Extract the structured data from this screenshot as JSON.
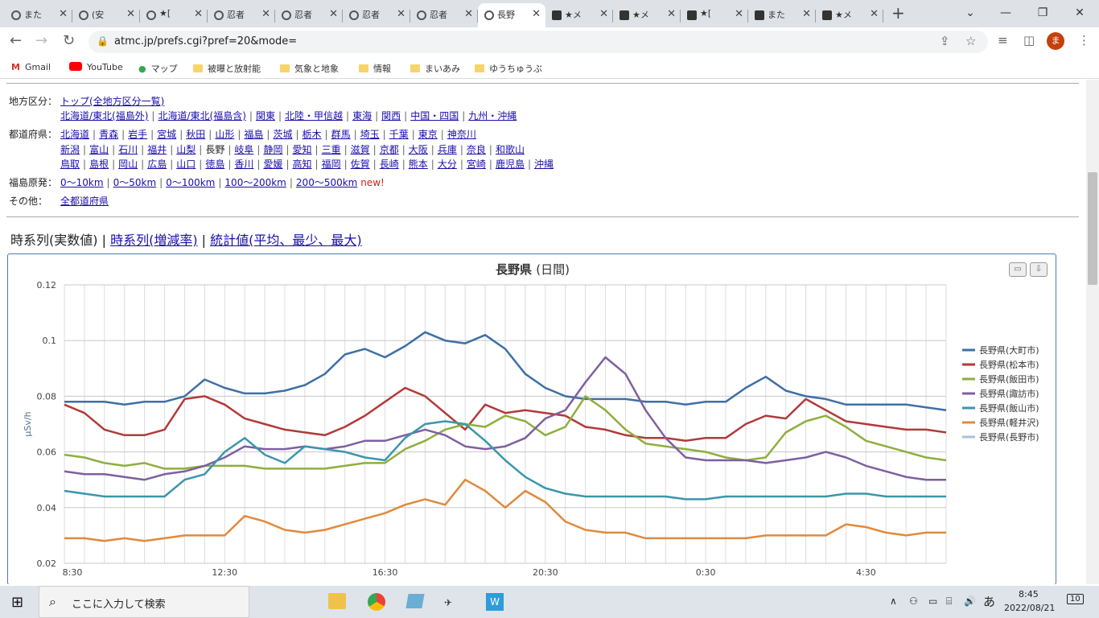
{
  "browser": {
    "tabs": [
      {
        "label": "また",
        "fav": "circle"
      },
      {
        "label": "(安",
        "fav": "circle"
      },
      {
        "label": "★[",
        "fav": "circle"
      },
      {
        "label": "忍者",
        "fav": "circle"
      },
      {
        "label": "忍者",
        "fav": "circle"
      },
      {
        "label": "忍者",
        "fav": "circle"
      },
      {
        "label": "忍者",
        "fav": "circle"
      },
      {
        "label": "長野",
        "fav": "circle",
        "active": true
      },
      {
        "label": "★メ",
        "fav": "square"
      },
      {
        "label": "★メ",
        "fav": "square"
      },
      {
        "label": "★[",
        "fav": "square"
      },
      {
        "label": "また",
        "fav": "square"
      },
      {
        "label": "★メ",
        "fav": "square"
      }
    ],
    "url": "atmc.jp/prefs.cgi?pref=20&mode=",
    "profile_initial": "ま",
    "bookmarks": [
      "Gmail",
      "YouTube",
      "マップ",
      "被曝と放射能",
      "気象と地象",
      "情報",
      "まいあみ",
      "ゆうちゅうぶ"
    ]
  },
  "nav": {
    "region": {
      "label": "地方区分：",
      "line1": [
        "トップ(全地方区分一覧)"
      ],
      "line2": [
        "北海道/東北(福島外)",
        "北海道/東北(福島含)",
        "関東",
        "北陸・甲信越",
        "東海",
        "関西",
        "中国・四国",
        "九州・沖縄"
      ]
    },
    "prefs": {
      "label": "都道府県：",
      "line1": [
        "北海道",
        "青森",
        "岩手",
        "宮城",
        "秋田",
        "山形",
        "福島",
        "茨城",
        "栃木",
        "群馬",
        "埼玉",
        "千葉",
        "東京",
        "神奈川"
      ],
      "line2": [
        "新潟",
        "富山",
        "石川",
        "福井",
        "山梨",
        "長野",
        "岐阜",
        "静岡",
        "愛知",
        "三重",
        "滋賀",
        "京都",
        "大阪",
        "兵庫",
        "奈良",
        "和歌山"
      ],
      "line3": [
        "鳥取",
        "島根",
        "岡山",
        "広島",
        "山口",
        "徳島",
        "香川",
        "愛媛",
        "高知",
        "福岡",
        "佐賀",
        "長崎",
        "熊本",
        "大分",
        "宮崎",
        "鹿児島",
        "沖縄"
      ]
    },
    "fukushima": {
      "label": "福島原発：",
      "items": [
        "0〜10km",
        "0〜50km",
        "0〜100km",
        "100〜200km",
        "200〜500km"
      ],
      "new": "new!"
    },
    "other": {
      "label": "その他：",
      "items": [
        "全都道府県"
      ]
    }
  },
  "views": {
    "current": "時系列(実数値)",
    "link1": "時系列(増減率)",
    "link2": "統計値(平均、最少、最大)",
    "sep": "|"
  },
  "chart_data": {
    "type": "line",
    "title": "長野県",
    "subtitle": "(日間)",
    "ylabel": "μSv/h",
    "ylim": [
      0.02,
      0.12
    ],
    "yticks": [
      "0.12",
      "0.1",
      "0.08",
      "0.06",
      "0.04",
      "0.02"
    ],
    "xticks": [
      "8:30",
      "12:30",
      "16:30",
      "20:30",
      "0:30",
      "4:30"
    ],
    "grid": true,
    "legend_position": "right",
    "series": [
      {
        "name": "長野県(大町市)",
        "color": "#3f6fa5",
        "values": [
          0.078,
          0.078,
          0.078,
          0.077,
          0.078,
          0.078,
          0.08,
          0.086,
          0.083,
          0.081,
          0.081,
          0.082,
          0.084,
          0.088,
          0.095,
          0.097,
          0.094,
          0.098,
          0.103,
          0.1,
          0.099,
          0.102,
          0.097,
          0.088,
          0.083,
          0.08,
          0.079,
          0.079,
          0.079,
          0.078,
          0.078,
          0.077,
          0.078,
          0.078,
          0.083,
          0.087,
          0.082,
          0.08,
          0.079,
          0.077,
          0.077,
          0.077,
          0.077,
          0.076,
          0.075
        ]
      },
      {
        "name": "長野県(松本市)",
        "color": "#b23a3a",
        "values": [
          0.077,
          0.074,
          0.068,
          0.066,
          0.066,
          0.068,
          0.079,
          0.08,
          0.077,
          0.072,
          0.07,
          0.068,
          0.067,
          0.066,
          0.069,
          0.073,
          0.078,
          0.083,
          0.08,
          0.074,
          0.068,
          0.077,
          0.074,
          0.075,
          0.074,
          0.073,
          0.069,
          0.068,
          0.066,
          0.065,
          0.065,
          0.064,
          0.065,
          0.065,
          0.07,
          0.073,
          0.072,
          0.079,
          0.075,
          0.071,
          0.07,
          0.069,
          0.068,
          0.068,
          0.067
        ]
      },
      {
        "name": "長野県(飯田市)",
        "color": "#8fae3e",
        "values": [
          0.059,
          0.058,
          0.056,
          0.055,
          0.056,
          0.054,
          0.054,
          0.055,
          0.055,
          0.055,
          0.054,
          0.054,
          0.054,
          0.054,
          0.055,
          0.056,
          0.056,
          0.061,
          0.064,
          0.068,
          0.07,
          0.069,
          0.073,
          0.071,
          0.066,
          0.069,
          0.08,
          0.075,
          0.068,
          0.063,
          0.062,
          0.061,
          0.06,
          0.058,
          0.057,
          0.058,
          0.067,
          0.071,
          0.073,
          0.069,
          0.064,
          0.062,
          0.06,
          0.058,
          0.057
        ]
      },
      {
        "name": "長野県(諏訪市)",
        "color": "#7e5fa0",
        "values": [
          0.053,
          0.052,
          0.052,
          0.051,
          0.05,
          0.052,
          0.053,
          0.055,
          0.058,
          0.062,
          0.061,
          0.061,
          0.062,
          0.061,
          0.062,
          0.064,
          0.064,
          0.066,
          0.068,
          0.066,
          0.062,
          0.061,
          0.062,
          0.065,
          0.072,
          0.075,
          0.085,
          0.094,
          0.088,
          0.075,
          0.065,
          0.058,
          0.057,
          0.057,
          0.057,
          0.056,
          0.057,
          0.058,
          0.06,
          0.058,
          0.055,
          0.053,
          0.051,
          0.05,
          0.05
        ]
      },
      {
        "name": "長野県(飯山市)",
        "color": "#3a96ad",
        "values": [
          0.046,
          0.045,
          0.044,
          0.044,
          0.044,
          0.044,
          0.05,
          0.052,
          0.06,
          0.065,
          0.059,
          0.056,
          0.062,
          0.061,
          0.06,
          0.058,
          0.057,
          0.065,
          0.07,
          0.071,
          0.07,
          0.064,
          0.057,
          0.051,
          0.047,
          0.045,
          0.044,
          0.044,
          0.044,
          0.044,
          0.044,
          0.043,
          0.043,
          0.044,
          0.044,
          0.044,
          0.044,
          0.044,
          0.044,
          0.045,
          0.045,
          0.044,
          0.044,
          0.044,
          0.044
        ]
      },
      {
        "name": "長野県(軽井沢)",
        "color": "#e08a3c",
        "values": [
          0.029,
          0.029,
          0.028,
          0.029,
          0.028,
          0.029,
          0.03,
          0.03,
          0.03,
          0.037,
          0.035,
          0.032,
          0.031,
          0.032,
          0.034,
          0.036,
          0.038,
          0.041,
          0.043,
          0.041,
          0.05,
          0.046,
          0.04,
          0.046,
          0.042,
          0.035,
          0.032,
          0.031,
          0.031,
          0.029,
          0.029,
          0.029,
          0.029,
          0.029,
          0.029,
          0.03,
          0.03,
          0.03,
          0.03,
          0.034,
          0.033,
          0.031,
          0.03,
          0.031,
          0.031
        ]
      },
      {
        "name": "長野県(長野市)",
        "color": "#a9c1de",
        "values": []
      }
    ]
  },
  "taskbar": {
    "search_placeholder": "ここに入力して検索",
    "time": "8:45",
    "date": "2022/08/21",
    "ime": "あ",
    "notif": "10"
  }
}
